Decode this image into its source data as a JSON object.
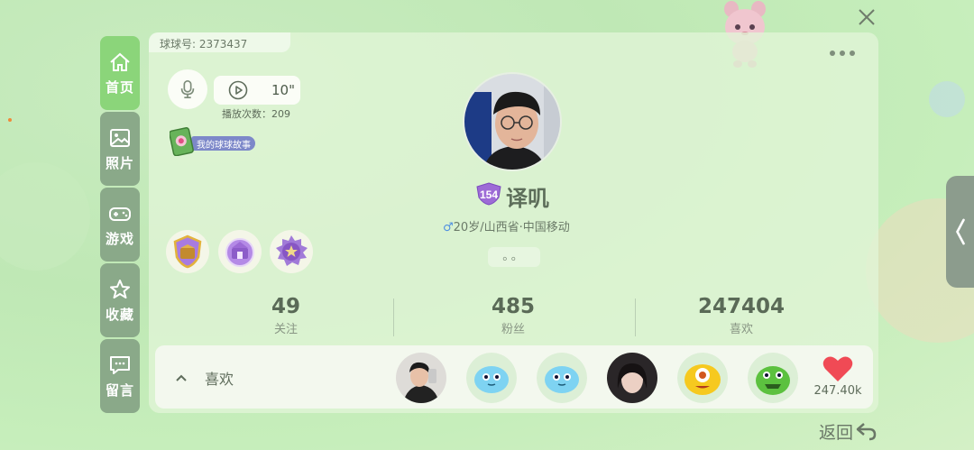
{
  "header": {
    "user_id_label": "球球号: 2373437"
  },
  "sidebar": {
    "items": [
      {
        "label": "首页",
        "icon": "home-icon",
        "active": true
      },
      {
        "label": "照片",
        "icon": "photo-icon",
        "active": false
      },
      {
        "label": "游戏",
        "icon": "gamepad-icon",
        "active": false
      },
      {
        "label": "收藏",
        "icon": "star-icon",
        "active": false
      },
      {
        "label": "留言",
        "icon": "message-icon",
        "active": false
      }
    ]
  },
  "voice": {
    "duration": "10\"",
    "play_count": "播放次数：209"
  },
  "story_badge": {
    "label": "我的球球故事"
  },
  "profile": {
    "level": "154",
    "name": "译叽",
    "gender_symbol": "♂",
    "info": "20岁/山西省·中国移动",
    "status": "。。"
  },
  "medals": [
    "medal-icon",
    "medal-icon",
    "medal-icon"
  ],
  "stats": [
    {
      "value": "49",
      "label": "关注"
    },
    {
      "value": "485",
      "label": "粉丝"
    },
    {
      "value": "247404",
      "label": "喜欢"
    }
  ],
  "likes": {
    "label": "喜欢",
    "count": "247.40k"
  },
  "footer": {
    "back_label": "返回"
  },
  "colors": {
    "accent_green": "#8bd57a",
    "sidebar_gray": "#8aa989",
    "heart_red": "#f04a55",
    "male_blue": "#4f8fe0"
  }
}
